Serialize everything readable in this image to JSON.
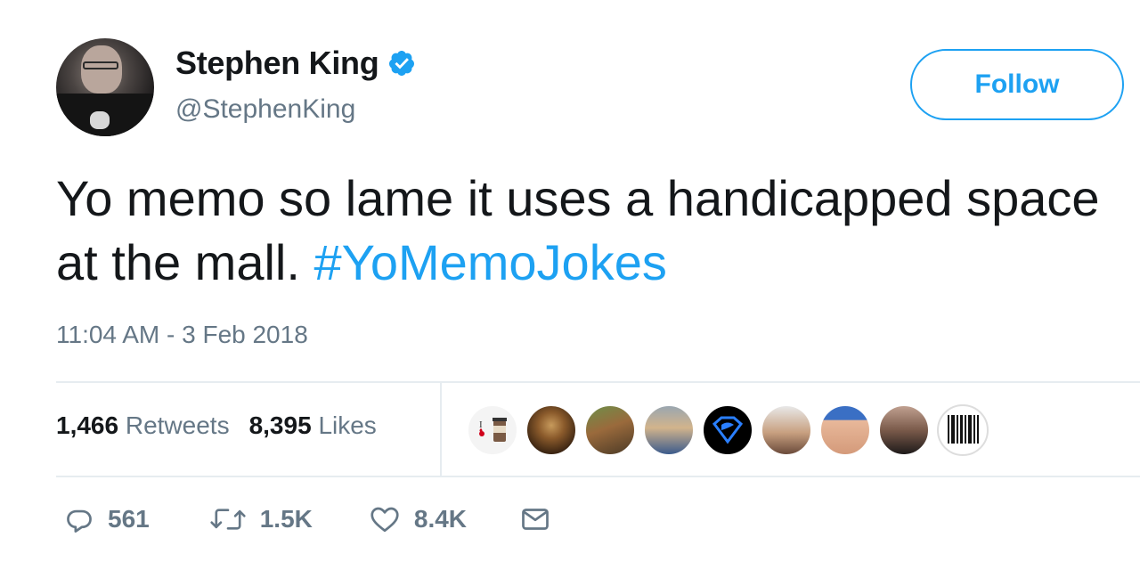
{
  "author": {
    "name": "Stephen King",
    "handle": "@StephenKing"
  },
  "follow_button": {
    "label": "Follow"
  },
  "tweet": {
    "text_main": "Yo memo so lame it uses a handicapped space at the mall. ",
    "hashtag": "#YoMemoJokes",
    "timestamp": "11:04 AM - 3 Feb 2018"
  },
  "stats": {
    "retweets_count": "1,466",
    "retweets_label": "Retweets",
    "likes_count": "8,395",
    "likes_label": "Likes"
  },
  "actions": {
    "reply_count": "561",
    "retweet_count": "1.5K",
    "like_count": "8.4K"
  },
  "colors": {
    "accent": "#1da1f2",
    "text": "#14171a",
    "secondary": "#657786",
    "divider": "#e6ecf0"
  },
  "likers": [
    {
      "name": "coffee-avatar"
    },
    {
      "name": "mona-lisa-avatar"
    },
    {
      "name": "outdoor-animal-avatar"
    },
    {
      "name": "two-people-avatar"
    },
    {
      "name": "superman-logo-avatar"
    },
    {
      "name": "couple-avatar"
    },
    {
      "name": "person-cap-avatar"
    },
    {
      "name": "person-sunglasses-avatar"
    },
    {
      "name": "barcode-avatar"
    }
  ]
}
